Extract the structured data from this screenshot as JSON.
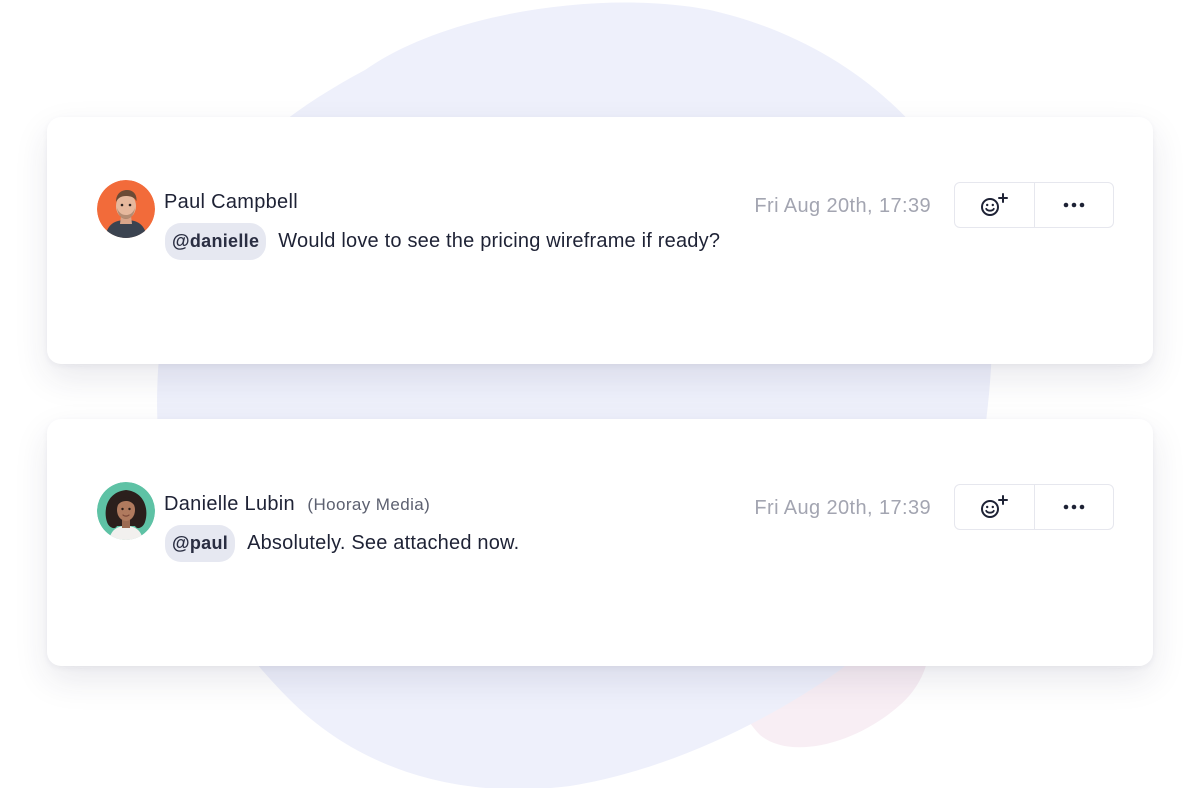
{
  "comments": [
    {
      "author": "Paul Campbell",
      "org": "",
      "timestamp": "Fri Aug 20th, 17:39",
      "mention": "@danielle",
      "message": "Would love to see the pricing wireframe if ready?",
      "avatar_color": "#f26b3a"
    },
    {
      "author": "Danielle Lubin",
      "org": "(Hooray Media)",
      "timestamp": "Fri Aug 20th, 17:39",
      "mention": "@paul",
      "message": "Absolutely. See attached now.",
      "avatar_color": "#5ec2a5"
    }
  ],
  "icons": {
    "reaction": "add-reaction-icon",
    "more": "more-options-icon"
  },
  "colors": {
    "blob": "#eef0fb",
    "blob_accent": "#f8eef4",
    "mention_bg": "#e6e8f1",
    "timestamp": "#a3a5b1"
  }
}
